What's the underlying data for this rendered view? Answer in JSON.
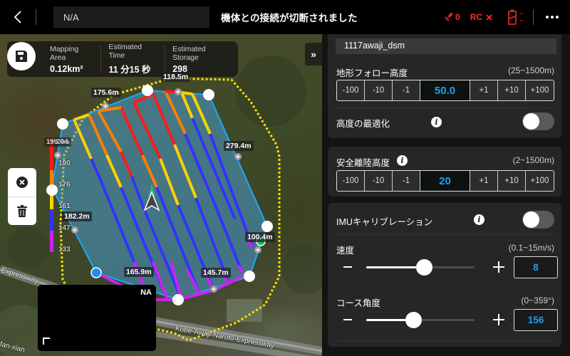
{
  "topbar": {
    "back_icon": "chevron-left-icon",
    "mission_name": "N/A",
    "status_message": "機体との接続が切断されました",
    "satellite_count": "0",
    "rc_label": "RC",
    "rc_status_icon": "x-icon",
    "battery_top": "--",
    "battery_bottom": "--",
    "more_icon": "more-horizontal-icon"
  },
  "map": {
    "info": {
      "save_icon": "save-icon",
      "items": [
        {
          "label": "Mapping Area",
          "value": "0.12km²"
        },
        {
          "label": "Estimated Time",
          "value": "11 分15 秒"
        },
        {
          "label": "Estimated Storage",
          "value": "298"
        }
      ]
    },
    "expand_icon": "»",
    "tools": [
      {
        "name": "close-circle-icon"
      },
      {
        "name": "trash-icon"
      }
    ],
    "distance_labels": [
      "118.5m",
      "175.6m",
      "279.4m",
      "199.4m",
      "182.2m",
      "100.4m",
      "165.9m",
      "145.7m"
    ],
    "altitude_legend": {
      "values": [
        "204",
        "190",
        "176",
        "161",
        "147",
        "133"
      ],
      "colors": [
        "#ff1a1a",
        "#ff8000",
        "#ffd000",
        "#3333ff",
        "#cc22ee"
      ]
    },
    "camera": {
      "label": "NA"
    },
    "road_labels": [
      "Expressway",
      "Kobe-Awaji-Naruto-Expressway",
      "fan-xian"
    ],
    "colors": {
      "boundary": "#ffe000",
      "polygon_fill": "#4aa3e0",
      "polygon_edge": "#1eaaf1"
    }
  },
  "panel": {
    "mission_file": "1117awaji_dsm",
    "terrain_follow": {
      "title": "地形フォロー高度",
      "range": "(25~1500m)",
      "steps_minus": [
        "-100",
        "-10",
        "-1"
      ],
      "value": "50.0",
      "steps_plus": [
        "+1",
        "+10",
        "+100"
      ]
    },
    "altitude_optimization": {
      "title": "高度の最適化",
      "enabled": false
    },
    "safe_takeoff": {
      "title": "安全離陸高度",
      "range": "(2~1500m)",
      "steps_minus": [
        "-100",
        "-10",
        "-1"
      ],
      "value": "20",
      "steps_plus": [
        "+1",
        "+10",
        "+100"
      ]
    },
    "imu_calibration": {
      "title": "IMUキャリブレーション",
      "enabled": false
    },
    "speed": {
      "title": "速度",
      "range": "(0.1~15m/s)",
      "value": "8",
      "min": 0.1,
      "max": 15
    },
    "course_angle": {
      "title": "コース角度",
      "range": "(0~359°)",
      "value": "156",
      "min": 0,
      "max": 359
    }
  }
}
